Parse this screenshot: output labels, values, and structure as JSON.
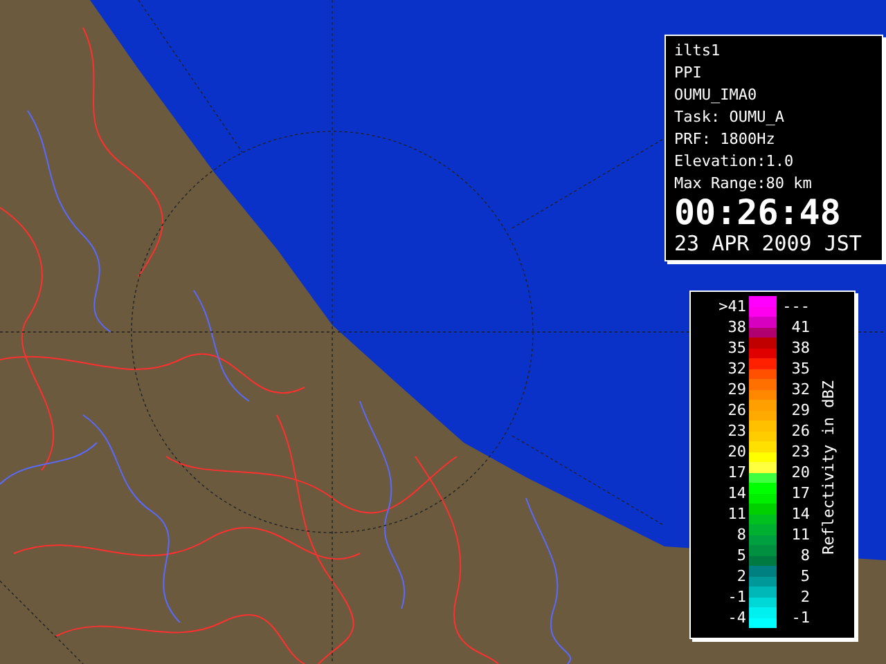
{
  "info_panel": {
    "lines": [
      "ilts1",
      "PPI",
      "OUMU_IMA0",
      "Task: OUMU_A",
      "PRF: 1800Hz",
      "Elevation:1.0",
      "Max Range:80 km"
    ],
    "time": "00:26:48",
    "date": "23 APR 2009 JST"
  },
  "legend": {
    "title": "Reflectivity in dBZ",
    "rows": [
      {
        "low": ">41",
        "high": "---"
      },
      {
        "low": "38",
        "high": "41"
      },
      {
        "low": "35",
        "high": "38"
      },
      {
        "low": "32",
        "high": "35"
      },
      {
        "low": "29",
        "high": "32"
      },
      {
        "low": "26",
        "high": "29"
      },
      {
        "low": "23",
        "high": "26"
      },
      {
        "low": "20",
        "high": "23"
      },
      {
        "low": "17",
        "high": "20"
      },
      {
        "low": "14",
        "high": "17"
      },
      {
        "low": "11",
        "high": "14"
      },
      {
        "low": "8",
        "high": "11"
      },
      {
        "low": "5",
        "high": "8"
      },
      {
        "low": "2",
        "high": "5"
      },
      {
        "low": "-1",
        "high": "2"
      },
      {
        "low": "-4",
        "high": "-1"
      }
    ],
    "swatches": [
      {
        "color": "#ff00ff"
      },
      {
        "color": "#ff00ee"
      },
      {
        "color": "#d800c0"
      },
      {
        "color": "#b00070"
      },
      {
        "color": "#c00000"
      },
      {
        "color": "#e00000"
      },
      {
        "color": "#ff2000"
      },
      {
        "color": "#ff5000"
      },
      {
        "color": "#ff7000"
      },
      {
        "color": "#ff8800"
      },
      {
        "color": "#ffa000"
      },
      {
        "color": "#ffaa00"
      },
      {
        "color": "#ffc000"
      },
      {
        "color": "#ffcc00"
      },
      {
        "color": "#ffe000"
      },
      {
        "color": "#ffff00"
      },
      {
        "color": "#ffff40"
      },
      {
        "color": "#40ff40"
      },
      {
        "color": "#00ff00"
      },
      {
        "color": "#00ee00"
      },
      {
        "color": "#00d000"
      },
      {
        "color": "#00c020"
      },
      {
        "color": "#00b030"
      },
      {
        "color": "#00a040"
      },
      {
        "color": "#009040"
      },
      {
        "color": "#007a40"
      },
      {
        "color": "#008080"
      },
      {
        "color": "#009898"
      },
      {
        "color": "#00b8b8"
      },
      {
        "color": "#00d8d8"
      },
      {
        "color": "#00f0f0"
      },
      {
        "color": "#00ffff"
      }
    ]
  }
}
